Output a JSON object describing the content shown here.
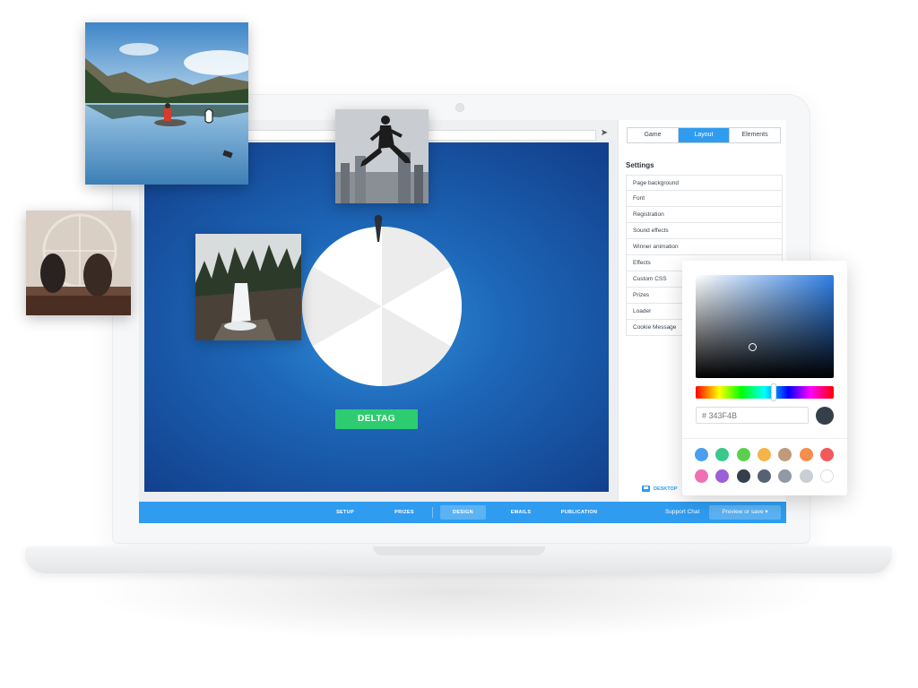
{
  "editor": {
    "tabs": [
      {
        "label": "Game",
        "active": false
      },
      {
        "label": "Layout",
        "active": true
      },
      {
        "label": "Elements",
        "active": false
      }
    ],
    "settings_title": "Settings",
    "settings_items": [
      "Page background",
      "Font",
      "Registration",
      "Sound effects",
      "Winner animation",
      "Effects",
      "Custom CSS",
      "Prizes",
      "Loader",
      "Cookie Message"
    ],
    "device_toggle": "DESKTOP"
  },
  "preview": {
    "cta_label": "DELTAG",
    "wheel_colors": [
      "#ececec",
      "#ffffff"
    ]
  },
  "bottom_nav": {
    "items": [
      {
        "label": "SETUP",
        "active": false
      },
      {
        "label": "PRIZES",
        "active": false
      },
      {
        "label": "DESIGN",
        "active": true
      },
      {
        "label": "EMAILS",
        "active": false
      },
      {
        "label": "PUBLICATION",
        "active": false
      }
    ],
    "support_label": "Support Chat",
    "preview_save_label": "Preview or save ▾"
  },
  "color_picker": {
    "hex_placeholder": "# 343F4B",
    "current_color": "#343F4B",
    "hue_color": "#2f80e6",
    "swatches": [
      "#4a9ff0",
      "#38c88a",
      "#5dcf4e",
      "#f5b44a",
      "#bf9a7c",
      "#f58d4c",
      "#f05a5a",
      "#ef6fb4",
      "#9b5fd8",
      "#343f4b",
      "#566273",
      "#9099a5",
      "#c9ced4",
      "#ffffff"
    ]
  },
  "colors": {
    "accent": "#2f9cf0",
    "cta_green": "#2ecc71",
    "preview_blue": "#1e67b8"
  },
  "icons": [
    "send-icon",
    "desktop-icon",
    "hand-cursor-icon",
    "chevron-down-icon"
  ]
}
